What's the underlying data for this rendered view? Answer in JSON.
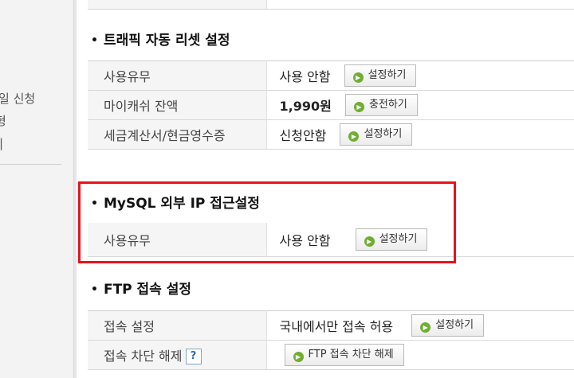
{
  "sidebar": {
    "items": [
      "일 신청",
      "형",
      "|"
    ]
  },
  "sections": [
    {
      "title": "트래픽 자동 리셋 설정",
      "rows": [
        {
          "label": "사용유무",
          "value": "사용 안함",
          "button": "설정하기"
        },
        {
          "label": "마이캐쉬 잔액",
          "value": "1,990원",
          "button": "충전하기"
        },
        {
          "label": "세금계산서/현금영수증",
          "value": "신청안함",
          "button": "설정하기"
        }
      ]
    },
    {
      "title": "MySQL 외부 IP 접근설정",
      "rows": [
        {
          "label": "사용유무",
          "value": "사용 안함",
          "button": "설정하기"
        }
      ]
    },
    {
      "title": "FTP 접속 설정",
      "rows": [
        {
          "label": "접속 설정",
          "value": "국내에서만 접속 허용",
          "button": "설정하기"
        },
        {
          "label": "접속 차단 해제",
          "help": "?",
          "value": "",
          "button": "FTP 접속 차단 해제"
        }
      ]
    }
  ],
  "colors": {
    "highlight_border": "#e8121c",
    "button_icon": "#6fae2f"
  }
}
